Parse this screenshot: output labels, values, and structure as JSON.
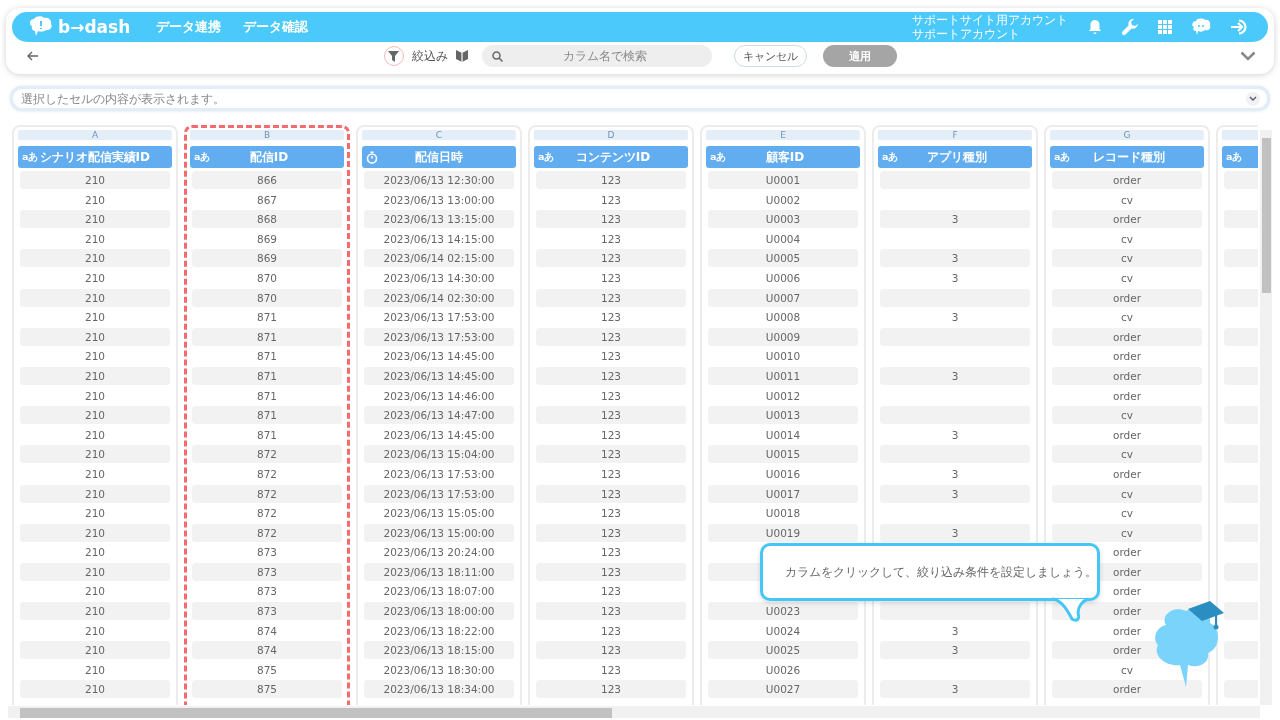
{
  "app": {
    "logo": "b→dash",
    "nav": [
      {
        "label": "データ連携"
      },
      {
        "label": "データ確認"
      }
    ],
    "account": {
      "site": "サポートサイト用アカウント",
      "user": "サポートアカウント"
    }
  },
  "toolbar": {
    "filter_label": "絞込み",
    "search": {
      "placeholder": "カラム名で検索"
    },
    "buttons": [
      {
        "label": "キャンセル",
        "disabled": false
      },
      {
        "label": "適用",
        "disabled": true
      }
    ]
  },
  "cell_viewer": {
    "placeholder": "選択したセルの内容が表示されます。"
  },
  "table": {
    "columns": [
      {
        "letter": "A",
        "title": "シナリオ配信実績ID",
        "kind": "text",
        "type_label": "aあ",
        "highlighted": false
      },
      {
        "letter": "B",
        "title": "配信ID",
        "kind": "text",
        "type_label": "aあ",
        "highlighted": true
      },
      {
        "letter": "C",
        "title": "配信日時",
        "kind": "datetime",
        "highlighted": false
      },
      {
        "letter": "D",
        "title": "コンテンツID",
        "kind": "text",
        "type_label": "aあ",
        "highlighted": false
      },
      {
        "letter": "E",
        "title": "顧客ID",
        "kind": "text",
        "type_label": "aあ",
        "highlighted": false
      },
      {
        "letter": "F",
        "title": "アプリ種別",
        "kind": "text",
        "type_label": "aあ",
        "highlighted": false
      },
      {
        "letter": "G",
        "title": "レコード種別",
        "kind": "text",
        "type_label": "aあ",
        "highlighted": false
      },
      {
        "kind": "text",
        "type_label": "aあ",
        "highlighted": false
      }
    ],
    "rows": [
      [
        "210",
        "866",
        "2023/06/13 12:30:00",
        "123",
        "U0001",
        null,
        "order"
      ],
      [
        "210",
        "867",
        "2023/06/13 13:00:00",
        "123",
        "U0002",
        null,
        "cv"
      ],
      [
        "210",
        "868",
        "2023/06/13 13:15:00",
        "123",
        "U0003",
        "3",
        "order"
      ],
      [
        "210",
        "869",
        "2023/06/13 14:15:00",
        "123",
        "U0004",
        null,
        "cv"
      ],
      [
        "210",
        "869",
        "2023/06/14 02:15:00",
        "123",
        "U0005",
        "3",
        "cv"
      ],
      [
        "210",
        "870",
        "2023/06/13 14:30:00",
        "123",
        "U0006",
        "3",
        "cv"
      ],
      [
        "210",
        "870",
        "2023/06/14 02:30:00",
        "123",
        "U0007",
        null,
        "order"
      ],
      [
        "210",
        "871",
        "2023/06/13 17:53:00",
        "123",
        "U0008",
        "3",
        "cv"
      ],
      [
        "210",
        "871",
        "2023/06/13 17:53:00",
        "123",
        "U0009",
        null,
        "order"
      ],
      [
        "210",
        "871",
        "2023/06/13 14:45:00",
        "123",
        "U0010",
        null,
        "order"
      ],
      [
        "210",
        "871",
        "2023/06/13 14:45:00",
        "123",
        "U0011",
        "3",
        "order"
      ],
      [
        "210",
        "871",
        "2023/06/13 14:46:00",
        "123",
        "U0012",
        null,
        "order"
      ],
      [
        "210",
        "871",
        "2023/06/13 14:47:00",
        "123",
        "U0013",
        null,
        "cv"
      ],
      [
        "210",
        "871",
        "2023/06/13 14:45:00",
        "123",
        "U0014",
        "3",
        "order"
      ],
      [
        "210",
        "872",
        "2023/06/13 15:04:00",
        "123",
        "U0015",
        null,
        "cv"
      ],
      [
        "210",
        "872",
        "2023/06/13 17:53:00",
        "123",
        "U0016",
        "3",
        "order"
      ],
      [
        "210",
        "872",
        "2023/06/13 17:53:00",
        "123",
        "U0017",
        "3",
        "cv"
      ],
      [
        "210",
        "872",
        "2023/06/13 15:05:00",
        "123",
        "U0018",
        null,
        "cv"
      ],
      [
        "210",
        "872",
        "2023/06/13 15:00:00",
        "123",
        "U0019",
        "3",
        "cv"
      ],
      [
        "210",
        "873",
        "2023/06/13 20:24:00",
        "123",
        null,
        null,
        "order"
      ],
      [
        "210",
        "873",
        "2023/06/13 18:11:00",
        "123",
        null,
        null,
        "order"
      ],
      [
        "210",
        "873",
        "2023/06/13 18:07:00",
        "123",
        null,
        null,
        "order"
      ],
      [
        "210",
        "873",
        "2023/06/13 18:00:00",
        "123",
        "U0023",
        null,
        "order"
      ],
      [
        "210",
        "874",
        "2023/06/13 18:22:00",
        "123",
        "U0024",
        "3",
        "order"
      ],
      [
        "210",
        "874",
        "2023/06/13 18:15:00",
        "123",
        "U0025",
        "3",
        "order"
      ],
      [
        "210",
        "875",
        "2023/06/13 18:30:00",
        "123",
        "U0026",
        null,
        "cv"
      ],
      [
        "210",
        "875",
        "2023/06/13 18:34:00",
        "123",
        "U0027",
        "3",
        "order"
      ]
    ]
  },
  "tooltip": {
    "text": "カラムをクリックして、絞り込み条件を設定しましょう。"
  }
}
